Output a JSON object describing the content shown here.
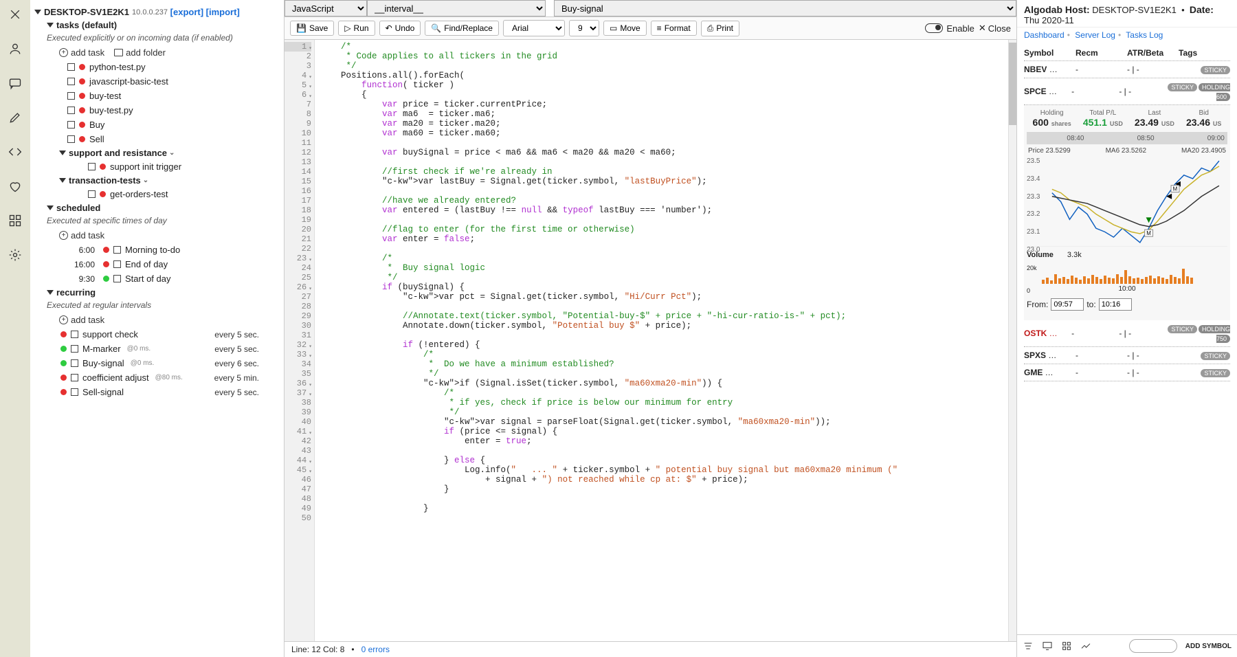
{
  "rail_icons": [
    "close",
    "user",
    "chat",
    "pencil",
    "code",
    "heart",
    "apps",
    "gear"
  ],
  "host": {
    "name": "DESKTOP-SV1E2K1",
    "ip": "10.0.0.237",
    "export": "[export]",
    "import": "[import]"
  },
  "sidebar": {
    "tasks_default": {
      "title": "tasks (default)",
      "desc": "Executed explicitly or on incoming data (if enabled)",
      "add_task": "add task",
      "add_folder": "add folder",
      "items": [
        {
          "label": "python-test.py",
          "dot": "red"
        },
        {
          "label": "javascript-basic-test",
          "dot": "red"
        },
        {
          "label": "buy-test",
          "dot": "red"
        },
        {
          "label": "buy-test.py",
          "dot": "red"
        },
        {
          "label": "Buy",
          "dot": "red"
        },
        {
          "label": "Sell",
          "dot": "red"
        }
      ],
      "support_folder": {
        "title": "support and resistance",
        "items": [
          {
            "label": "support init trigger",
            "dot": "red"
          }
        ]
      },
      "trans_folder": {
        "title": "transaction-tests",
        "items": [
          {
            "label": "get-orders-test",
            "dot": "red"
          }
        ]
      }
    },
    "scheduled": {
      "title": "scheduled",
      "desc": "Executed at specific times of day",
      "add_task": "add task",
      "items": [
        {
          "time": "6:00",
          "dot": "red",
          "label": "Morning to-do"
        },
        {
          "time": "16:00",
          "dot": "red",
          "label": "End of day"
        },
        {
          "time": "9:30",
          "dot": "green",
          "label": "Start of day"
        }
      ]
    },
    "recurring": {
      "title": "recurring",
      "desc": "Executed at regular intervals",
      "add_task": "add task",
      "items": [
        {
          "dot": "red",
          "label": "support check",
          "ms": "",
          "every": "every 5 sec."
        },
        {
          "dot": "green",
          "label": "M-marker",
          "ms": "@0 ms.",
          "every": "every 5 sec."
        },
        {
          "dot": "green",
          "label": "Buy-signal",
          "ms": "@0 ms.",
          "every": "every 6 sec."
        },
        {
          "dot": "red",
          "label": "coefficient adjust",
          "ms": "@80 ms.",
          "every": "every 5 min."
        },
        {
          "dot": "red",
          "label": "Sell-signal",
          "ms": "",
          "every": "every 5 sec."
        }
      ]
    }
  },
  "selects": {
    "lang": "JavaScript",
    "scope": "__interval__",
    "script": "Buy-signal"
  },
  "toolbar": {
    "save": "Save",
    "run": "Run",
    "undo": "Undo",
    "find": "Find/Replace",
    "font": "Arial",
    "size": "9",
    "move": "Move",
    "format": "Format",
    "print": "Print",
    "enable": "Enable",
    "close": "Close"
  },
  "code_lines": [
    {
      "t": "    /*",
      "cls": "c-com"
    },
    {
      "t": "     * Code applies to all tickers in the grid",
      "cls": "c-com"
    },
    {
      "t": "     */",
      "cls": "c-com"
    },
    {
      "t": "    Positions.all().forEach("
    },
    {
      "t": "        function( ticker )",
      "kw": "function"
    },
    {
      "t": "        {"
    },
    {
      "t": "            var price = ticker.currentPrice;",
      "kw": "var"
    },
    {
      "t": "            var ma6  = ticker.ma6;",
      "kw": "var"
    },
    {
      "t": "            var ma20 = ticker.ma20;",
      "kw": "var"
    },
    {
      "t": "            var ma60 = ticker.ma60;",
      "kw": "var"
    },
    {
      "t": ""
    },
    {
      "t": "            var buySignal = price < ma6 && ma6 < ma20 && ma20 < ma60;",
      "kw": "var"
    },
    {
      "t": ""
    },
    {
      "t": "            //first check if we're already in",
      "cls": "c-com"
    },
    {
      "t": "            var lastBuy = Signal.get(ticker.symbol, \"lastBuyPrice\");",
      "kw": "var",
      "str": true
    },
    {
      "t": ""
    },
    {
      "t": "            //have we already entered?",
      "cls": "c-com"
    },
    {
      "t": "            var entered = (lastBuy !== null && typeof lastBuy === 'number');",
      "kw": "var"
    },
    {
      "t": ""
    },
    {
      "t": "            //flag to enter (for the first time or otherwise)",
      "cls": "c-com"
    },
    {
      "t": "            var enter = false;",
      "kw": "var"
    },
    {
      "t": ""
    },
    {
      "t": "            /*",
      "cls": "c-com"
    },
    {
      "t": "             *  Buy signal logic",
      "cls": "c-com"
    },
    {
      "t": "             */",
      "cls": "c-com"
    },
    {
      "t": "            if (buySignal) {",
      "kw": "if"
    },
    {
      "t": "                var pct = Signal.get(ticker.symbol, \"Hi/Curr Pct\");",
      "kw": "var",
      "str": true
    },
    {
      "t": ""
    },
    {
      "t": "                //Annotate.text(ticker.symbol, \"Potential-buy-$\" + price + \"-hi-cur-ratio-is-\" + pct);",
      "cls": "c-com"
    },
    {
      "t": "                Annotate.down(ticker.symbol, \"Potential buy $\" + price);",
      "str": true
    },
    {
      "t": ""
    },
    {
      "t": "                if (!entered) {",
      "kw": "if"
    },
    {
      "t": "                    /*",
      "cls": "c-com"
    },
    {
      "t": "                     *  Do we have a minimum established?",
      "cls": "c-com"
    },
    {
      "t": "                     */",
      "cls": "c-com"
    },
    {
      "t": "                    if (Signal.isSet(ticker.symbol, \"ma60xma20-min\")) {",
      "kw": "if",
      "str": true
    },
    {
      "t": "                        /*",
      "cls": "c-com"
    },
    {
      "t": "                         * if yes, check if price is below our minimum for entry",
      "cls": "c-com"
    },
    {
      "t": "                         */",
      "cls": "c-com"
    },
    {
      "t": "                        var signal = parseFloat(Signal.get(ticker.symbol, \"ma60xma20-min\"));",
      "kw": "var",
      "str": true
    },
    {
      "t": "                        if (price <= signal) {",
      "kw": "if"
    },
    {
      "t": "                            enter = true;"
    },
    {
      "t": ""
    },
    {
      "t": "                        } else {",
      "kw": "else"
    },
    {
      "t": "                            Log.info(\"   ... \" + ticker.symbol + \" potential buy signal but ma60xma20 minimum (\"",
      "str": true
    },
    {
      "t": "                                + signal + \") not reached while cp at: $\" + price);",
      "str": true
    },
    {
      "t": "                        }"
    },
    {
      "t": ""
    },
    {
      "t": "                    }"
    },
    {
      "t": ""
    }
  ],
  "status": {
    "line": "Line: 12 Col: 8",
    "errors": "0 errors"
  },
  "right": {
    "host_label": "Algodab Host:",
    "host": "DESKTOP-SV1E2K1",
    "date_label": "Date:",
    "date": "Thu 2020-11",
    "tabs": [
      "Dashboard",
      "Server Log",
      "Tasks Log"
    ],
    "cols": [
      "Symbol",
      "Recm",
      "ATR/Beta",
      "Tags"
    ],
    "rows": [
      {
        "sym": "NBEV",
        "recm": "-",
        "ab": "- | -",
        "tags": [
          "STICKY"
        ]
      },
      {
        "sym": "SPCE",
        "recm": "-",
        "ab": "- | -",
        "tags": [
          "STICKY",
          "HOLDING 600"
        ],
        "expand": true
      },
      {
        "sym": "OSTK",
        "recm": "-",
        "ab": "- | -",
        "tags": [
          "STICKY",
          "HOLDING 750"
        ],
        "red": true
      },
      {
        "sym": "SPXS",
        "recm": "-",
        "ab": "- | -",
        "tags": [
          "STICKY"
        ]
      },
      {
        "sym": "GME",
        "recm": "-",
        "ab": "- | -",
        "tags": [
          "STICKY"
        ]
      }
    ],
    "metrics": {
      "holding": {
        "lbl": "Holding",
        "val": "600",
        "unit": "shares"
      },
      "pl": {
        "lbl": "Total P/L",
        "val": "451.1",
        "unit": "USD"
      },
      "last": {
        "lbl": "Last",
        "val": "23.49",
        "unit": "USD"
      },
      "bid": {
        "lbl": "Bid",
        "val": "23.46",
        "unit": "US"
      }
    },
    "times": {
      "t1": "08:40",
      "t2": "08:50",
      "t3": "09:00"
    },
    "pricebar": {
      "price_l": "Price",
      "price_v": "23.5299",
      "ma6_l": "MA6",
      "ma6_v": "23.5262",
      "ma20_l": "MA20",
      "ma20_v": "23.4905"
    },
    "ylabels": [
      "23.5",
      "23.4",
      "23.3",
      "23.2",
      "23.1",
      "23.0"
    ],
    "vol": {
      "label": "Volume",
      "val": "3.3k",
      "yk": "20k",
      "y0": "0",
      "time": "10:00"
    },
    "fromto": {
      "from_l": "From:",
      "from": "09:57",
      "to_l": "to:",
      "to": "10:16"
    },
    "add_symbol": "ADD SYMBOL"
  },
  "chart_data": {
    "type": "line",
    "title": "",
    "xlabel": "",
    "ylabel": "",
    "ylim": [
      23.0,
      23.5
    ],
    "x_range": [
      "09:57",
      "10:16"
    ],
    "series": [
      {
        "name": "Price",
        "color": "#1060c0",
        "values": [
          23.3,
          23.25,
          23.15,
          23.22,
          23.18,
          23.1,
          23.08,
          23.05,
          23.1,
          23.06,
          23.02,
          23.1,
          23.2,
          23.28,
          23.35,
          23.4,
          23.38,
          23.44,
          23.42,
          23.48
        ]
      },
      {
        "name": "MA6",
        "color": "#c9b22a",
        "values": [
          23.32,
          23.3,
          23.26,
          23.24,
          23.22,
          23.18,
          23.15,
          23.12,
          23.1,
          23.08,
          23.07,
          23.09,
          23.14,
          23.2,
          23.26,
          23.32,
          23.36,
          23.4,
          23.42,
          23.45
        ]
      },
      {
        "name": "MA20",
        "color": "#333333",
        "values": [
          23.28,
          23.27,
          23.26,
          23.25,
          23.24,
          23.22,
          23.2,
          23.18,
          23.16,
          23.14,
          23.12,
          23.11,
          23.12,
          23.14,
          23.17,
          23.2,
          23.24,
          23.28,
          23.31,
          23.34
        ]
      }
    ],
    "markers": [
      {
        "x_index": 11,
        "kind": "down-arrow",
        "color": "green",
        "label": "M"
      },
      {
        "x_index": 14,
        "kind": "left-arrow",
        "color": "black",
        "label": "M"
      },
      {
        "x_index": 13,
        "kind": "left-arrow",
        "color": "black"
      }
    ],
    "volume_bars": [
      6,
      9,
      5,
      14,
      8,
      10,
      7,
      12,
      9,
      6,
      11,
      8,
      13,
      10,
      7,
      12,
      9,
      8,
      14,
      10,
      20,
      11,
      8,
      9,
      7,
      10,
      12,
      8,
      11,
      9,
      7,
      13,
      10,
      8,
      22,
      11,
      9
    ]
  }
}
